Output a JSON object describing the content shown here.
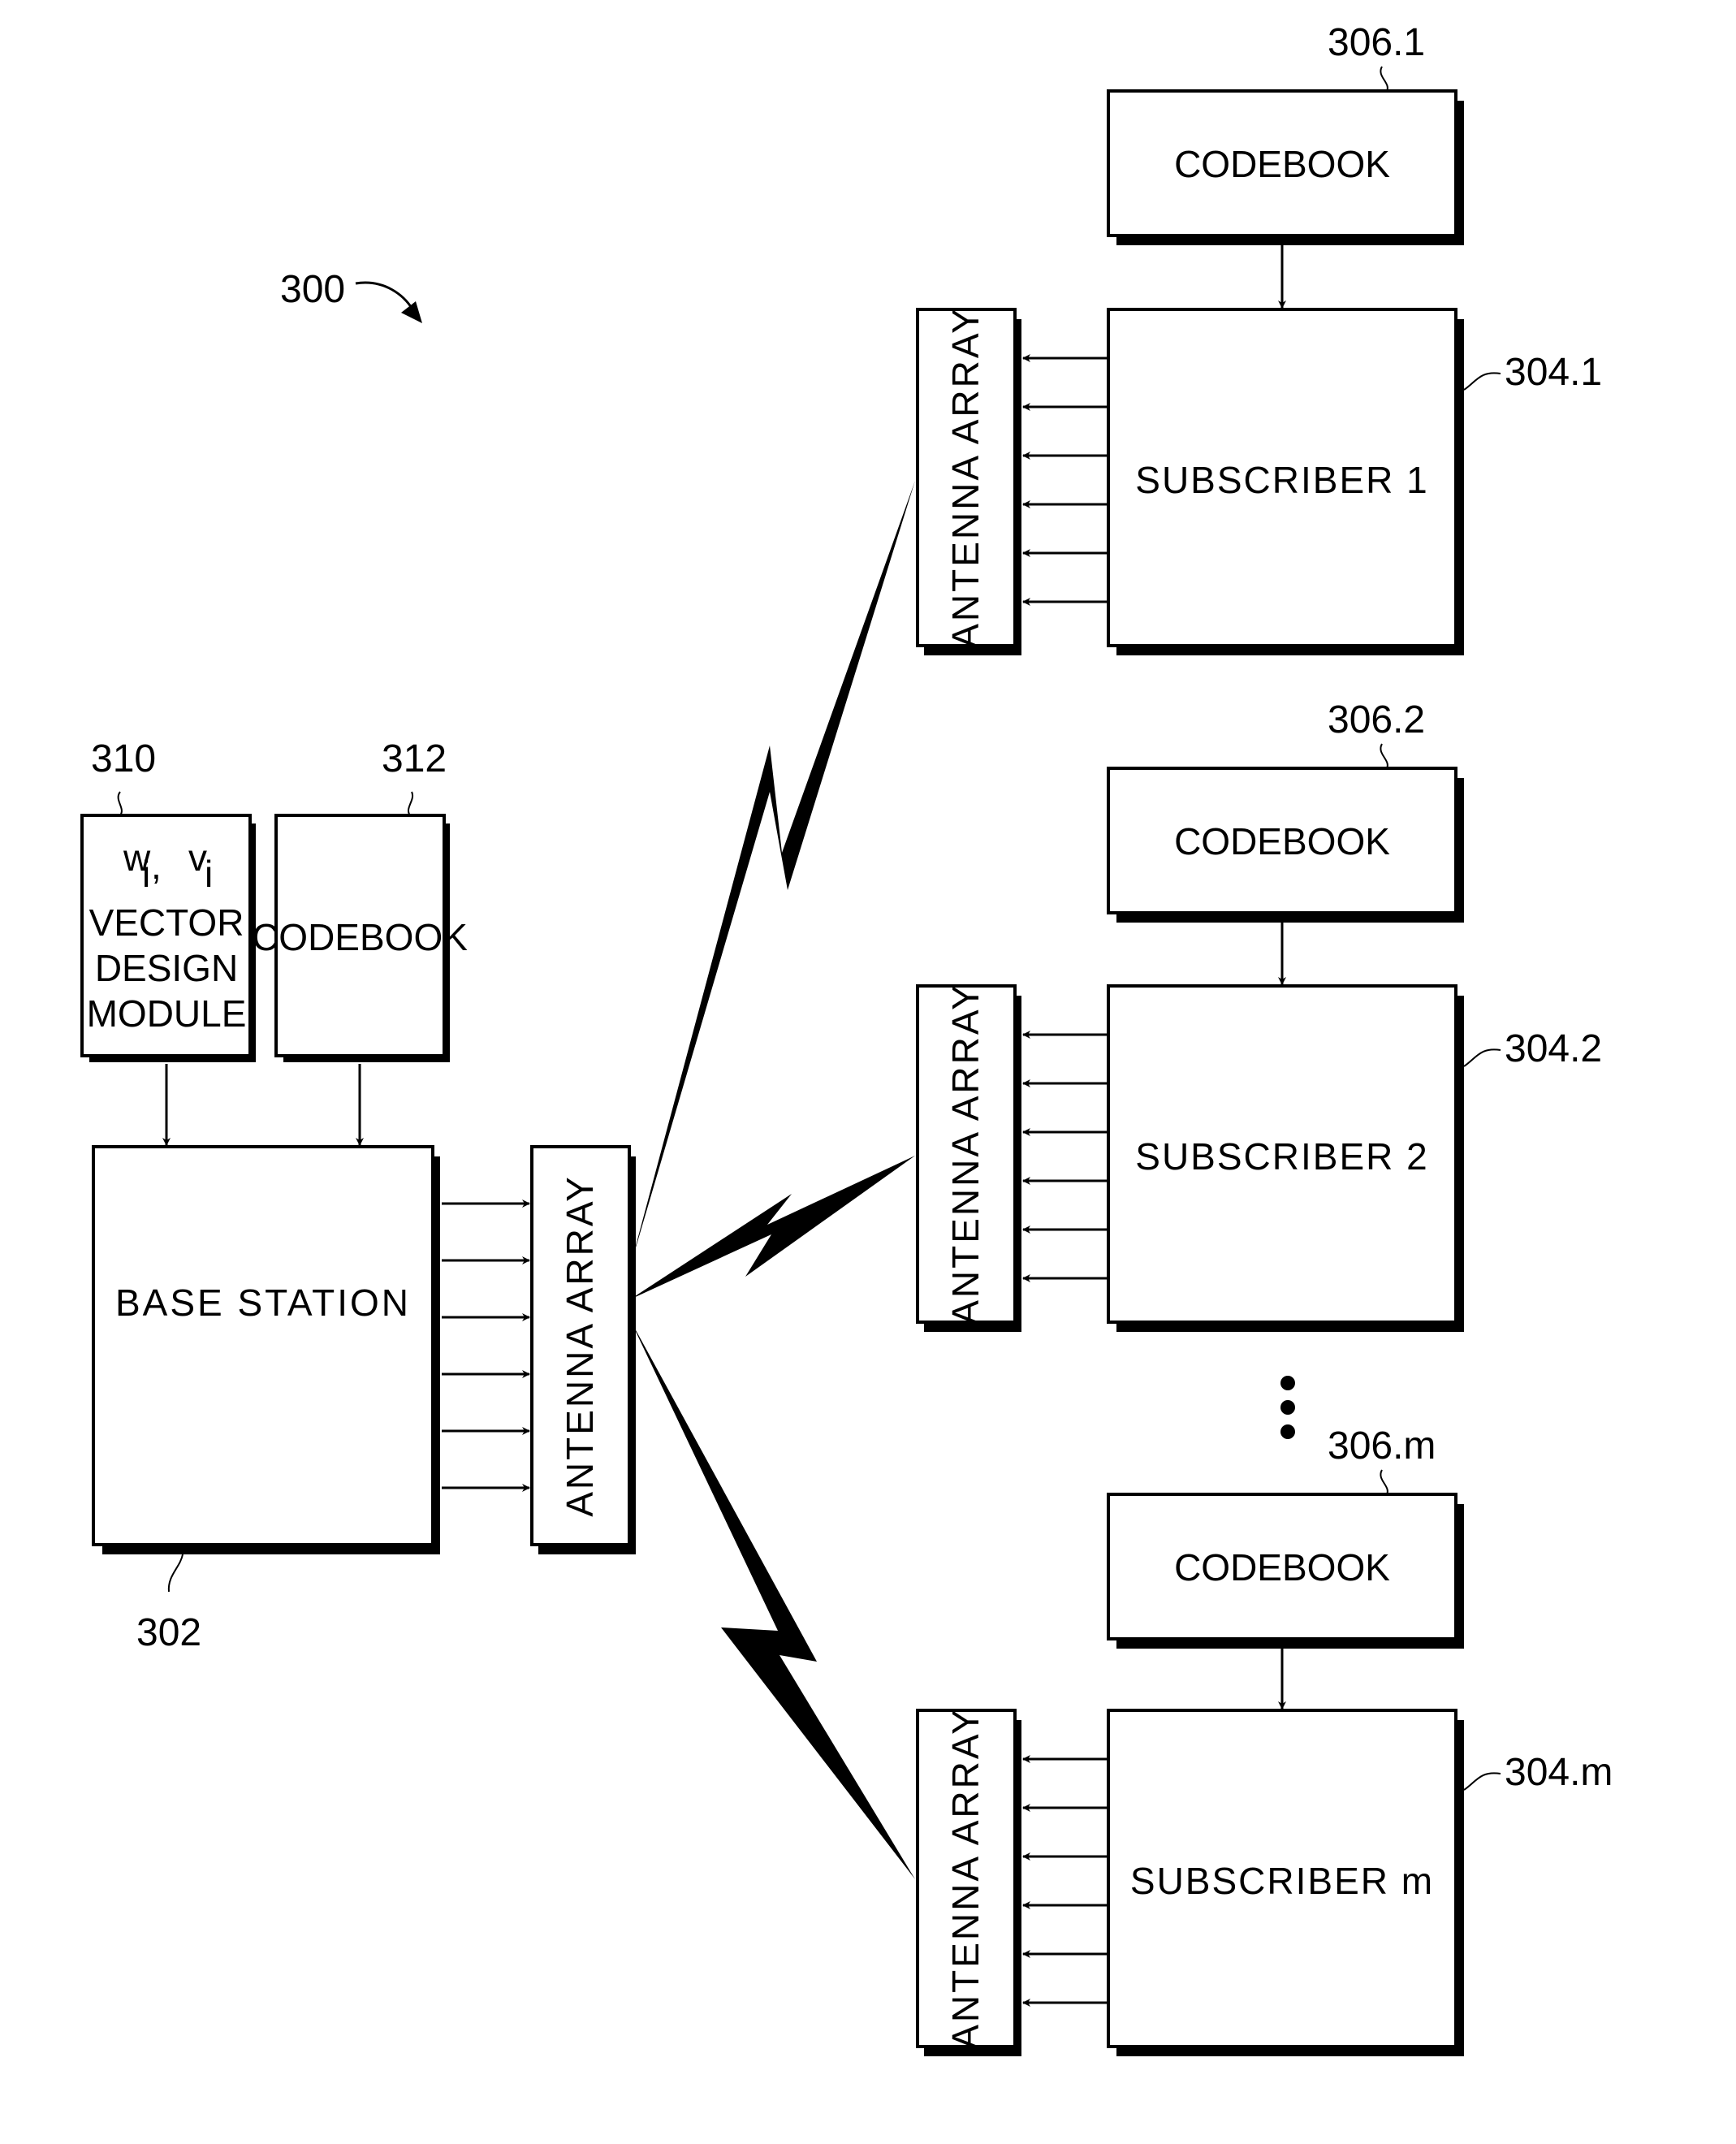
{
  "figure": {
    "ref_label": "300",
    "base_station": {
      "label": "BASE STATION",
      "ref": "302"
    },
    "vector_design_module": {
      "line1_w": "w",
      "line1_w_sub": "i",
      "line1_sep": ",",
      "line1_v": "v",
      "line1_v_sub": "i",
      "line2": "VECTOR",
      "line3": "DESIGN",
      "line4": "MODULE",
      "ref": "310"
    },
    "bs_codebook": {
      "label": "CODEBOOK",
      "ref": "312"
    },
    "bs_antenna": {
      "label": "ANTENNA ARRAY"
    },
    "subscribers": [
      {
        "label": "SUBSCRIBER 1",
        "ref": "304.1",
        "codebook_label": "CODEBOOK",
        "codebook_ref": "306.1",
        "antenna_label": "ANTENNA ARRAY"
      },
      {
        "label": "SUBSCRIBER 2",
        "ref": "304.2",
        "codebook_label": "CODEBOOK",
        "codebook_ref": "306.2",
        "antenna_label": "ANTENNA ARRAY"
      },
      {
        "label": "SUBSCRIBER m",
        "ref": "304.m",
        "codebook_label": "CODEBOOK",
        "codebook_ref": "306.m",
        "antenna_label": "ANTENNA ARRAY"
      }
    ],
    "ellipsis": "⋮",
    "arrows_per_antenna": 6
  }
}
